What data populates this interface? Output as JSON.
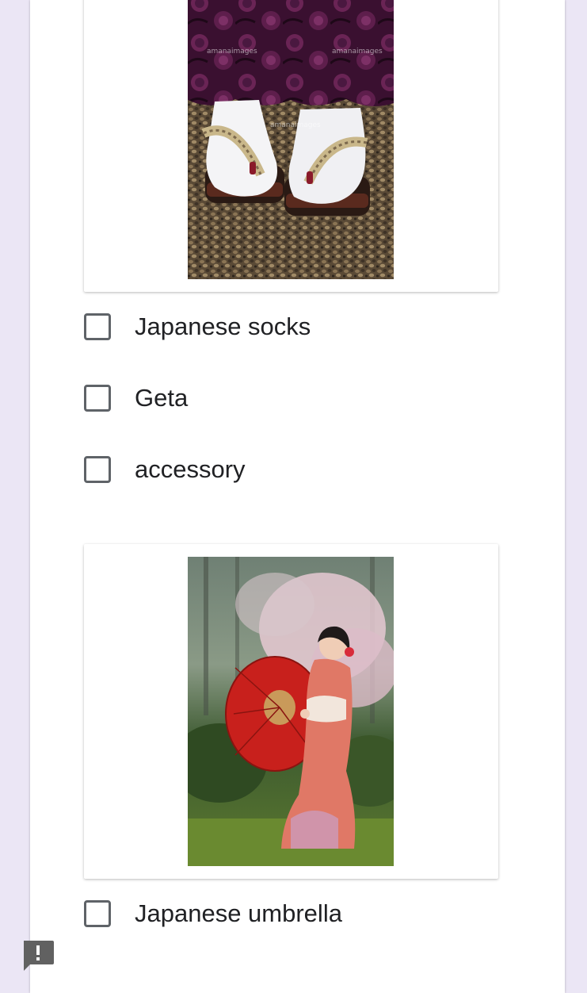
{
  "question_items": [
    {
      "image_alt": "Feet in white tabi socks and striped-strap geta sandals beneath a purple kimono hem",
      "options": [
        {
          "label": "Japanese socks",
          "checked": false
        },
        {
          "label": "Geta",
          "checked": false
        },
        {
          "label": "accessory",
          "checked": false
        }
      ]
    },
    {
      "image_alt": "Woman in a red floral kimono holding a red paper umbrella in a garden",
      "options": [
        {
          "label": "Japanese umbrella",
          "checked": false
        }
      ]
    }
  ],
  "watermark_text": "amanaimages",
  "icons": {
    "checkbox": "checkbox-unchecked-icon",
    "feedback": "report-feedback-icon"
  },
  "colors": {
    "page_background": "#ebe6f5",
    "card": "#ffffff",
    "checkbox_border": "#5f6368",
    "text": "#202124",
    "feedback_icon": "#616161"
  }
}
